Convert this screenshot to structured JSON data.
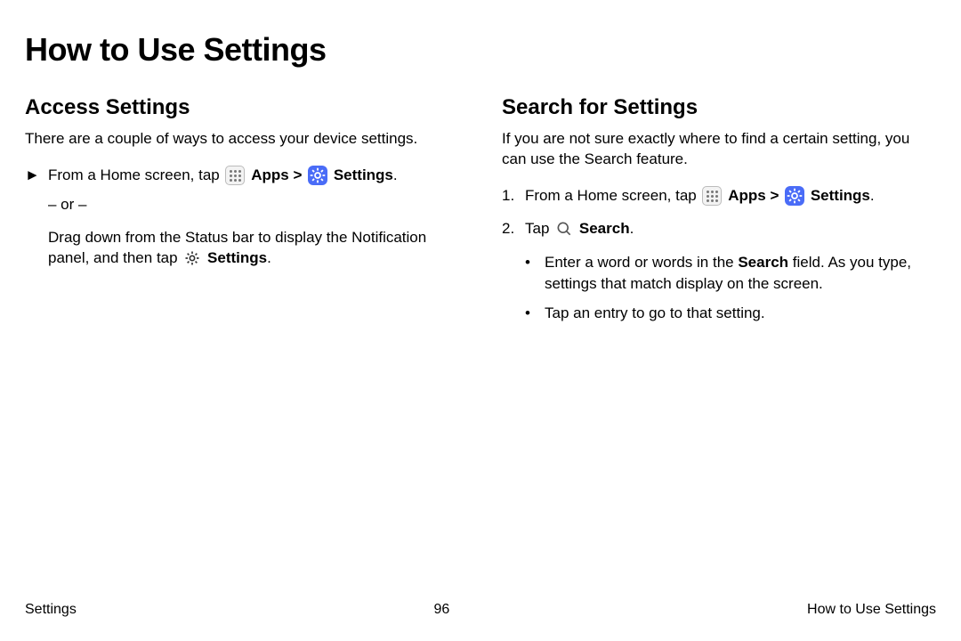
{
  "title": "How to Use Settings",
  "left": {
    "heading": "Access Settings",
    "intro": "There are a couple of ways to access your device settings.",
    "step_prefix": "From a Home screen, tap ",
    "apps_label": "Apps",
    "sep": " > ",
    "settings_label": "Settings",
    "period": ".",
    "or_text": "– or –",
    "drag_a": "Drag down from the Status bar to display the Notification panel, and then tap ",
    "drag_b": "Settings",
    "drag_c": "."
  },
  "right": {
    "heading": "Search for Settings",
    "intro": "If you are not sure exactly where to find a certain setting, you can use the Search feature.",
    "s1_num": "1.",
    "s1_prefix": "From a Home screen, tap ",
    "apps_label": "Apps",
    "sep": " > ",
    "settings_label": "Settings",
    "period": ".",
    "s2_num": "2.",
    "s2_prefix": "Tap ",
    "search_label": "Search",
    "b1a": "Enter a word or words in the ",
    "b1b": "Search",
    "b1c": " field. As you type, settings that match display on the screen.",
    "b2": "Tap an entry to go to that setting."
  },
  "footer": {
    "left": "Settings",
    "center": "96",
    "right": "How to Use Settings"
  }
}
